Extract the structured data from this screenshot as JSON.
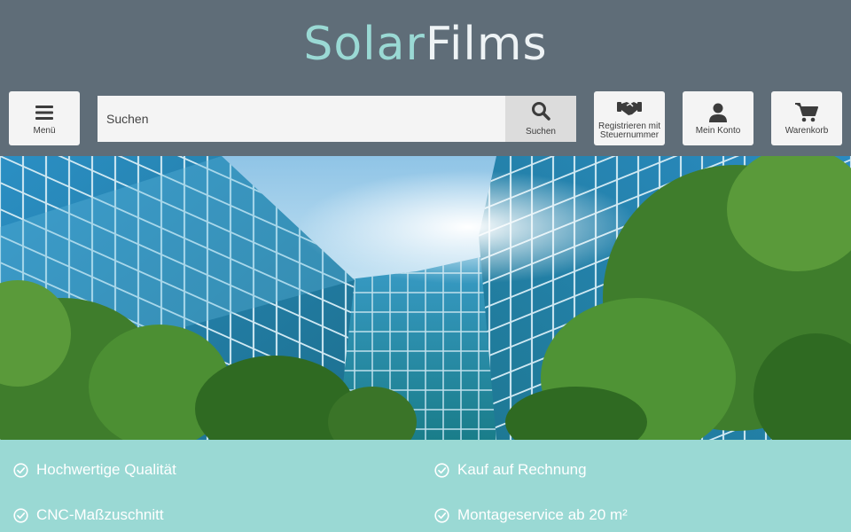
{
  "logo": {
    "part1": "Solar",
    "part2": "Films",
    "color_part1": "#9ad9d4",
    "color_part2": "#eef3f5"
  },
  "header": {
    "background": "#5f6d78"
  },
  "nav": {
    "menu": {
      "label": "Menü",
      "icon": "hamburger-icon"
    },
    "search": {
      "placeholder": "Suchen",
      "button_label": "Suchen",
      "icon": "search-icon"
    },
    "register": {
      "label_line1": "Registrieren mit",
      "label_line2": "Steuernummer",
      "icon": "handshake-icon"
    },
    "account": {
      "label": "Mein Konto",
      "icon": "user-icon"
    },
    "cart": {
      "label": "Warenkorb",
      "icon": "cart-icon"
    }
  },
  "hero": {
    "image": "glass-office-buildings-with-trees"
  },
  "usps": {
    "background": "#9ad9d4",
    "items": [
      "Hochwertige Qualität",
      "Kauf auf Rechnung",
      "CNC-Maßzuschnitt",
      "Montageservice ab 20 m²"
    ],
    "icon": "check-circle-icon"
  }
}
